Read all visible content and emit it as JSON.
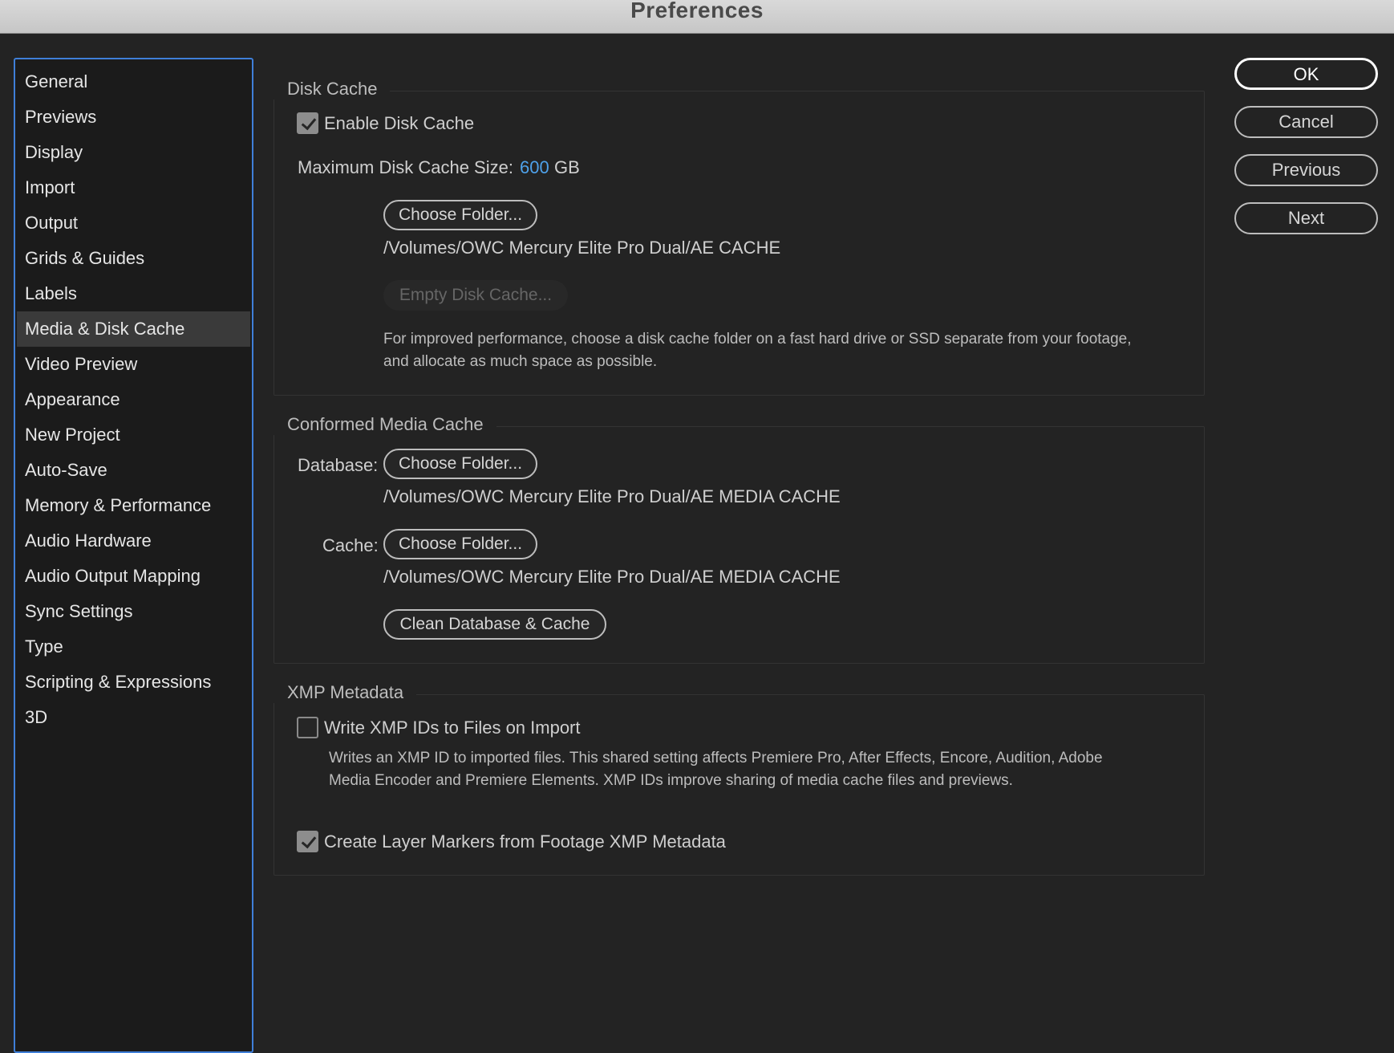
{
  "window": {
    "title": "Preferences"
  },
  "sidebar": {
    "items": [
      {
        "label": "General"
      },
      {
        "label": "Previews"
      },
      {
        "label": "Display"
      },
      {
        "label": "Import"
      },
      {
        "label": "Output"
      },
      {
        "label": "Grids & Guides"
      },
      {
        "label": "Labels"
      },
      {
        "label": "Media & Disk Cache",
        "selected": true
      },
      {
        "label": "Video Preview"
      },
      {
        "label": "Appearance"
      },
      {
        "label": "New Project"
      },
      {
        "label": "Auto-Save"
      },
      {
        "label": "Memory & Performance"
      },
      {
        "label": "Audio Hardware"
      },
      {
        "label": "Audio Output Mapping"
      },
      {
        "label": "Sync Settings"
      },
      {
        "label": "Type"
      },
      {
        "label": "Scripting & Expressions"
      },
      {
        "label": "3D"
      }
    ]
  },
  "disk_cache": {
    "title": "Disk Cache",
    "enable_label": "Enable Disk Cache",
    "enable_checked": true,
    "max_size_label": "Maximum Disk Cache Size:",
    "max_size_value": "600",
    "max_size_unit": "GB",
    "choose_folder": "Choose Folder...",
    "path": "/Volumes/OWC Mercury Elite Pro Dual/AE CACHE",
    "empty_button": "Empty Disk Cache...",
    "help_line1": "For improved performance, choose a disk cache folder on a fast hard drive or SSD separate from your footage,",
    "help_line2": "and allocate as much space as possible."
  },
  "conformed_media_cache": {
    "title": "Conformed Media Cache",
    "database_label": "Database:",
    "database_button": "Choose Folder...",
    "database_path": "/Volumes/OWC Mercury Elite Pro Dual/AE MEDIA CACHE",
    "cache_label": "Cache:",
    "cache_button": "Choose Folder...",
    "cache_path": "/Volumes/OWC Mercury Elite Pro Dual/AE MEDIA CACHE",
    "clean_button": "Clean Database & Cache"
  },
  "xmp_metadata": {
    "title": "XMP Metadata",
    "write_ids_label": "Write XMP IDs to Files on Import",
    "write_ids_checked": false,
    "write_ids_desc_line1": "Writes an XMP ID to imported files. This shared setting affects Premiere Pro, After Effects, Encore, Audition, Adobe",
    "write_ids_desc_line2": "Media Encoder and Premiere Elements. XMP IDs improve sharing of media cache files and previews.",
    "layer_markers_label": "Create Layer Markers from Footage XMP Metadata",
    "layer_markers_checked": true
  },
  "actions": {
    "ok": "OK",
    "cancel": "Cancel",
    "previous": "Previous",
    "next": "Next"
  }
}
